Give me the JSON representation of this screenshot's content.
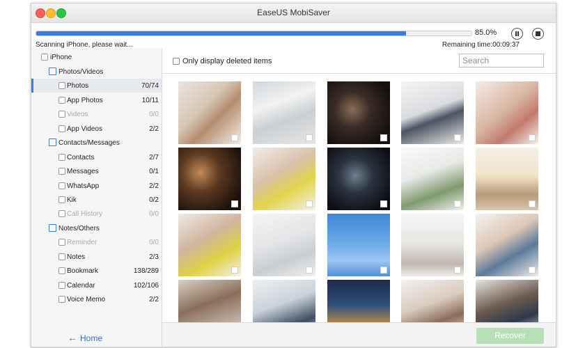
{
  "window": {
    "title": "EaseUS MobiSaver"
  },
  "progress": {
    "percent_label": "85.0%",
    "fraction": 0.85,
    "status": "Scanning iPhone, please wait...",
    "remaining": "Remaining time:00:09:37"
  },
  "sidebar": {
    "root": "iPhone",
    "categories": [
      {
        "label": "Photos/Videos",
        "icon": "photo-icon",
        "items": [
          {
            "label": "Photos",
            "count": "70/74",
            "selected": true
          },
          {
            "label": "App Photos",
            "count": "10/11"
          },
          {
            "label": "Videos",
            "count": "0/0",
            "disabled": true
          },
          {
            "label": "App Videos",
            "count": "2/2"
          }
        ]
      },
      {
        "label": "Contacts/Messages",
        "icon": "contacts-icon",
        "items": [
          {
            "label": "Contacts",
            "count": "2/7"
          },
          {
            "label": "Messages",
            "count": "0/1"
          },
          {
            "label": "WhatsApp",
            "count": "2/2"
          },
          {
            "label": "Kik",
            "count": "0/2"
          },
          {
            "label": "Call History",
            "count": "0/0",
            "disabled": true
          }
        ]
      },
      {
        "label": "Notes/Others",
        "icon": "notes-icon",
        "items": [
          {
            "label": "Reminder",
            "count": "0/0",
            "disabled": true
          },
          {
            "label": "Notes",
            "count": "2/3"
          },
          {
            "label": "Bookmark",
            "count": "138/289"
          },
          {
            "label": "Calendar",
            "count": "102/106"
          },
          {
            "label": "Voice Memo",
            "count": "2/2"
          }
        ]
      }
    ],
    "home_label": "Home"
  },
  "main": {
    "only_deleted_label": "Only display deleted items",
    "search_placeholder": "Search",
    "recover_label": "Recover"
  },
  "colors": {
    "accent": "#3a7de0",
    "recover_disabled": "#b8e0b7"
  }
}
